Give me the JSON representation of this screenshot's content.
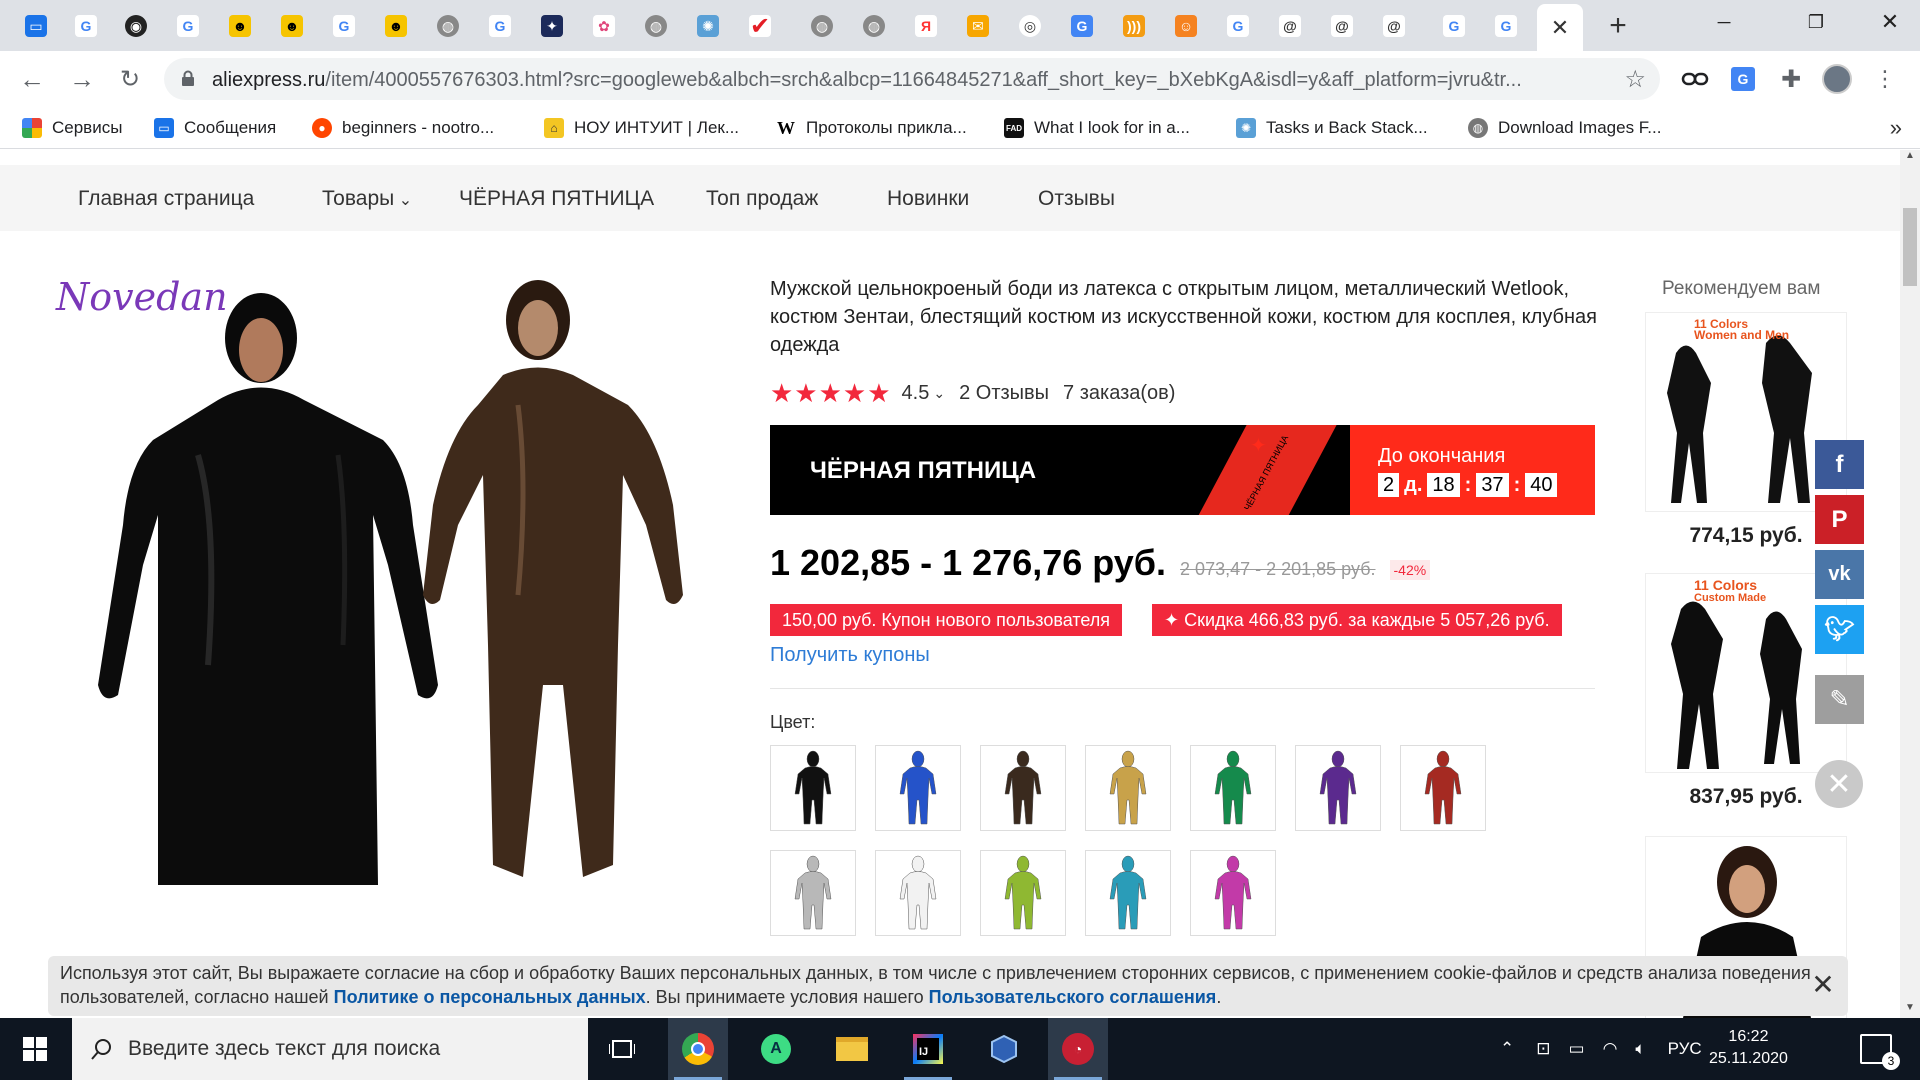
{
  "browser": {
    "url_domain": "aliexpress.ru",
    "url_path": "/item/4000557676303.html?src=googleweb&albch=srch&albcp=11664845271&aff_short_key=_bXebKgA&isdl=y&aff_platform=jvru&tr..."
  },
  "bookmarks": [
    {
      "label": "Сервисы",
      "icon": "apps-grid-icon"
    },
    {
      "label": "Сообщения",
      "icon": "messages-icon"
    },
    {
      "label": "beginners - nootro...",
      "icon": "reddit-icon"
    },
    {
      "label": "НОУ ИНТУИТ | Лек...",
      "icon": "intuit-icon"
    },
    {
      "label": "Протоколы прикла...",
      "icon": "wikipedia-icon"
    },
    {
      "label": "What I look for in a...",
      "icon": "fad-icon"
    },
    {
      "label": "Tasks и Back Stack...",
      "icon": "android-dev-icon"
    },
    {
      "label": "Download Images F...",
      "icon": "globe-icon"
    }
  ],
  "nav": [
    "Главная страница",
    "Товары",
    "ЧЁРНАЯ ПЯТНИЦА",
    "Топ продаж",
    "Новинки",
    "Отзывы"
  ],
  "product": {
    "brand_logo": "Novedan",
    "title": "Мужской цельнокроеный боди из латекса с открытым лицом, металлический Wetlook, костюм Зентаи, блестящий костюм из искусственной кожи, костюм для косплея, клубная одежда",
    "rating": "4.5",
    "reviews": "2 Отзывы",
    "orders": "7 заказа(ов)",
    "price_now": "1 202,85 - 1 276,76 руб.",
    "price_old": "2 073,47 - 2 201,85 руб.",
    "discount": "-42%",
    "coupon_new": "150,00 руб. Купон нового пользователя",
    "coupon_discount": "✦ Скидка 466,83 руб. за каждые 5 057,26 руб.",
    "get_coupons": "Получить купоны",
    "color_label": "Цвет:",
    "colors": [
      "#111111",
      "#2553c9",
      "#3a2a1e",
      "#c8a24a",
      "#158a4c",
      "#5b2a8e",
      "#a52a22",
      "#b8b8b8",
      "#f2f2f2",
      "#8fb832",
      "#2a9cb8",
      "#c23aa8"
    ]
  },
  "black_friday": {
    "title": "ЧЁРНАЯ ПЯТНИЦА",
    "stripe_text": "ЧЁРНАЯ ПЯТНИЦА",
    "ends_label": "До окончания",
    "days": "2",
    "days_unit": "д.",
    "hours": "18",
    "minutes": "37",
    "seconds": "40"
  },
  "recommend": {
    "title": "Рекомендуем вам",
    "items": [
      {
        "price": "774,15 руб.",
        "badge1": "11 Colors",
        "badge2": "Women and Men"
      },
      {
        "price": "837,95 руб.",
        "badge1": "11 Colors",
        "badge2": "Custom Made"
      }
    ]
  },
  "cookie": {
    "text1": "Используя этот сайт, Вы выражаете согласие на сбор и обработку Ваших персональных данных, в том числе с привлечением сторонних сервисов, с применением cookie-файлов и средств анализа поведения пользователей, согласно нашей ",
    "link1": "Политике о персональных данных",
    "text2": ". Вы принимаете условия нашего ",
    "link2": "Пользовательского соглашения",
    "text3": "."
  },
  "taskbar": {
    "search_placeholder": "Введите здесь текст для поиска",
    "language": "РУС",
    "time": "16:22",
    "date": "25.11.2020",
    "notifications": "3"
  }
}
